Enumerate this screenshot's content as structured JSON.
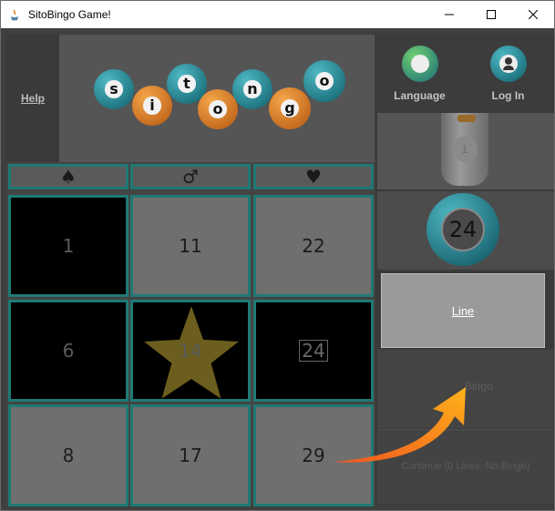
{
  "window": {
    "title": "SitoBingo Game!"
  },
  "header": {
    "help_label": "Help",
    "logo_letters": [
      "s",
      "i",
      "t",
      "o",
      "n",
      "g",
      "o"
    ],
    "columns": [
      "♠",
      "♂",
      "♥"
    ]
  },
  "board": {
    "cells": [
      {
        "value": "1",
        "marked": true
      },
      {
        "value": "11",
        "marked": false
      },
      {
        "value": "22",
        "marked": false
      },
      {
        "value": "6",
        "marked": true
      },
      {
        "value": "14",
        "marked": true,
        "star": true
      },
      {
        "value": "24",
        "marked": true,
        "boxed": true
      },
      {
        "value": "8",
        "marked": false
      },
      {
        "value": "17",
        "marked": false
      },
      {
        "value": "29",
        "marked": false
      }
    ]
  },
  "sidebar": {
    "language_label": "Language",
    "login_label": "Log In",
    "tube_ball": "1",
    "current_ball": "24",
    "line_label": "Line",
    "bingo_label": "Bingo",
    "continue_label": "Continue (0 Lines, No Bingo)"
  },
  "colors": {
    "teal_border": "#1e7a74",
    "star": "#6b5e1e",
    "arrow_start": "#f0561e",
    "arrow_end": "#ffb21a"
  }
}
